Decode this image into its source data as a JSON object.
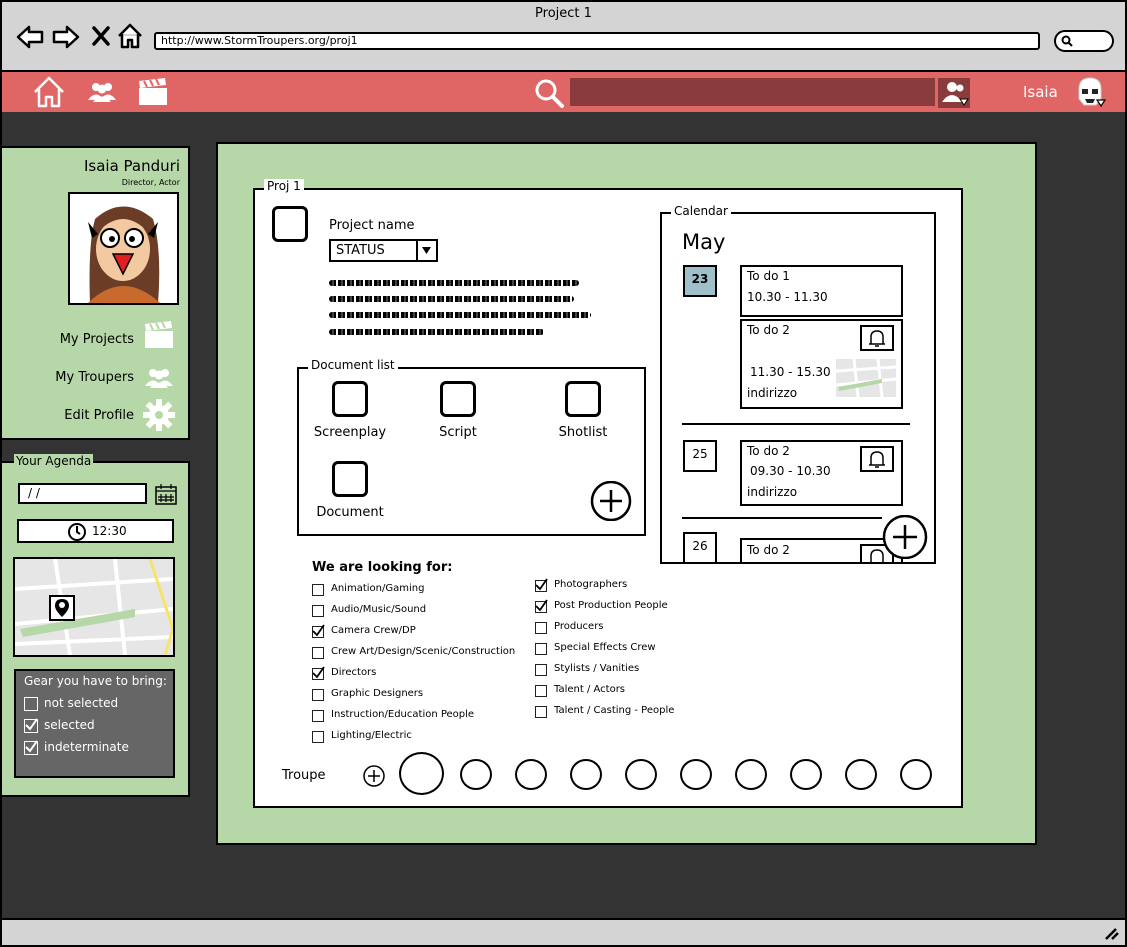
{
  "window": {
    "title": "Project 1",
    "url": "http://www.StormTroupers.org/proj1"
  },
  "colors": {
    "appbar": "#e06666",
    "search_field": "#8a3b3b",
    "panel_green": "#b6d7a8",
    "dark_bg": "#333333",
    "gear_box": "#666666",
    "status_day": "#9fbfc9"
  },
  "appbar": {
    "icons": [
      "home-icon",
      "people-icon",
      "clapperboard-icon",
      "search-icon",
      "user-menu-icon",
      "stormtrooper-avatar-icon"
    ],
    "username": "Isaia"
  },
  "profile": {
    "name": "Isaia Panduri",
    "roles": "Director,  Actor",
    "menu": [
      {
        "label": "My Projects",
        "icon": "clapperboard-icon"
      },
      {
        "label": "My Troupers",
        "icon": "people-icon"
      },
      {
        "label": "Edit Profile",
        "icon": "gear-icon"
      }
    ]
  },
  "agenda": {
    "title": "Your Agenda",
    "date_value": " /  /",
    "time_value": "12:30",
    "gear_title": "Gear you have to bring:",
    "gear": [
      {
        "label": "not selected",
        "checked": false
      },
      {
        "label": "selected",
        "checked": true
      },
      {
        "label": "indeterminate",
        "checked": true
      }
    ]
  },
  "project": {
    "legend": "Proj 1",
    "name_label": "Project name",
    "status": "STATUS",
    "documents": {
      "legend": "Document list",
      "items": [
        "Screenplay",
        "Script",
        "Shotlist",
        "Document"
      ]
    },
    "looking_for": {
      "title": "We are looking for:",
      "left": [
        {
          "label": "Animation/Gaming",
          "checked": false
        },
        {
          "label": "Audio/Music/Sound",
          "checked": false
        },
        {
          "label": "Camera Crew/DP",
          "checked": true
        },
        {
          "label": "Crew Art/Design/Scenic/Construction",
          "checked": false
        },
        {
          "label": "Directors",
          "checked": true
        },
        {
          "label": "Graphic Designers",
          "checked": false
        },
        {
          "label": "Instruction/Education People",
          "checked": false
        },
        {
          "label": "Lighting/Electric",
          "checked": false
        }
      ],
      "right": [
        {
          "label": "Photographers",
          "checked": true
        },
        {
          "label": "Post Production People",
          "checked": true
        },
        {
          "label": "Producers",
          "checked": false
        },
        {
          "label": "Special Effects Crew",
          "checked": false
        },
        {
          "label": "Stylists / Vanities",
          "checked": false
        },
        {
          "label": "Talent / Actors",
          "checked": false
        },
        {
          "label": "Talent / Casting - People",
          "checked": false
        }
      ]
    },
    "troupe_label": "Troupe"
  },
  "calendar": {
    "legend": "Calendar",
    "month": "May",
    "days": [
      {
        "day": "23",
        "events": [
          {
            "title": "To do 1",
            "time": "10.30 - 11.30",
            "place": "",
            "bell": false,
            "map": false
          },
          {
            "title": "To do 2",
            "time": "11.30 - 15.30",
            "place": "indirizzo",
            "bell": true,
            "map": true
          }
        ]
      },
      {
        "day": "25",
        "events": [
          {
            "title": "To do 2",
            "time": "09.30 - 10.30",
            "place": "indirizzo",
            "bell": true,
            "map": false
          }
        ]
      },
      {
        "day": "26",
        "events": [
          {
            "title": "To do 2",
            "time": "",
            "place": "",
            "bell": true,
            "map": false
          }
        ]
      }
    ]
  }
}
